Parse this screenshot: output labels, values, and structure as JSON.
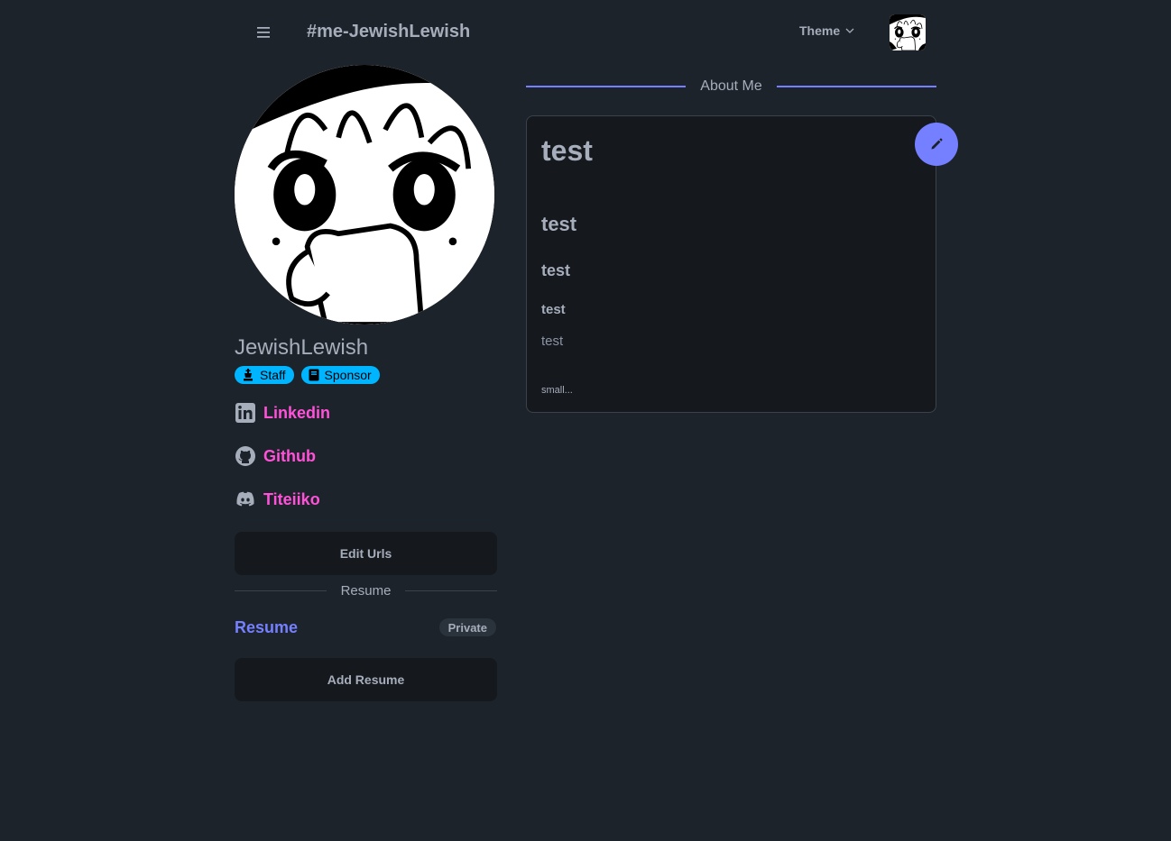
{
  "navbar": {
    "menu_icon": "hamburger-icon",
    "brand": "#me-JewishLewish",
    "theme_label": "Theme",
    "theme_icon": "chevron-down-icon"
  },
  "profile": {
    "username": "JewishLewish",
    "badges": [
      {
        "icon": "chess-king-icon",
        "label": "Staff"
      },
      {
        "icon": "book-icon",
        "label": "Sponsor"
      }
    ],
    "links": [
      {
        "icon": "linkedin-icon",
        "label": "Linkedin"
      },
      {
        "icon": "github-icon",
        "label": "Github"
      },
      {
        "icon": "discord-icon",
        "label": "Titeiiko"
      }
    ],
    "edit_urls_label": "Edit Urls",
    "resume_divider": "Resume",
    "resume_link": "Resume",
    "resume_visibility": "Private",
    "add_resume_label": "Add Resume"
  },
  "about": {
    "divider": "About Me",
    "edit_icon": "pencil-icon",
    "h1": "test",
    "h2": "test",
    "h3": "test",
    "h4": "test",
    "p": "test",
    "small": "small..."
  },
  "colors": {
    "background": "#1d232a",
    "card": "#15191e",
    "primary": "#7480ff",
    "secondary": "#ff52d9",
    "info": "#00b5ff",
    "text": "#a6adbb"
  }
}
